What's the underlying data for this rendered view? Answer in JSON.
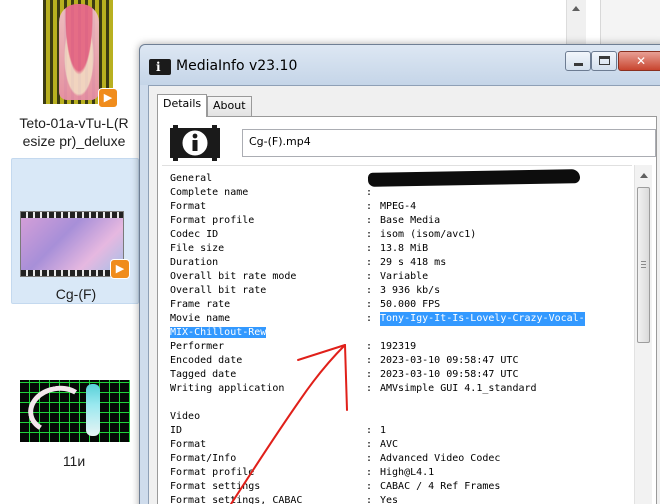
{
  "explorer": {
    "items": [
      {
        "label": "Teto-01a-vTu-L(Resize pr)_deluxe",
        "label_lines": [
          "Teto-01a-vTu-L(R",
          "esize pr)_deluxe"
        ],
        "selected": false
      },
      {
        "label": "Cg-(F)",
        "selected": true
      },
      {
        "label": "11и",
        "selected": false
      }
    ]
  },
  "window": {
    "title": "MediaInfo v23.10",
    "buttons": {
      "minimize_icon": "minimize-icon",
      "maximize_icon": "maximize-icon",
      "close_glyph": "✕"
    },
    "tabs": [
      {
        "label": "Details",
        "active": true
      },
      {
        "label": "About",
        "active": false
      }
    ],
    "file_name": "Cg-(F).mp4",
    "info": {
      "general": {
        "heading": "General",
        "rows": [
          {
            "key": "Complete name",
            "value": ""
          },
          {
            "key": "Format",
            "value": "MPEG-4"
          },
          {
            "key": "Format profile",
            "value": "Base Media"
          },
          {
            "key": "Codec ID",
            "value": "isom (isom/avc1)"
          },
          {
            "key": "File size",
            "value": "13.8 MiB"
          },
          {
            "key": "Duration",
            "value": "29 s 418 ms"
          },
          {
            "key": "Overall bit rate mode",
            "value": "Variable"
          },
          {
            "key": "Overall bit rate",
            "value": "3 936 kb/s"
          },
          {
            "key": "Frame rate",
            "value": "50.000 FPS"
          },
          {
            "key": "Movie name",
            "value": "Tony-Igy-It-Is-Lovely-Crazy-Vocal-",
            "value_continued": "MIX-Chillout-Rew"
          },
          {
            "key": "Performer",
            "value": "192319"
          },
          {
            "key": "Encoded date",
            "value": "2023-03-10 09:58:47 UTC"
          },
          {
            "key": "Tagged date",
            "value": "2023-03-10 09:58:47 UTC"
          },
          {
            "key": "Writing application",
            "value": "AMVsimple GUI 4.1_standard"
          }
        ]
      },
      "video": {
        "heading": "Video",
        "rows": [
          {
            "key": "ID",
            "value": "1"
          },
          {
            "key": "Format",
            "value": "AVC"
          },
          {
            "key": "Format/Info",
            "value": "Advanced Video Codec"
          },
          {
            "key": "Format profile",
            "value": "High@L4.1"
          },
          {
            "key": "Format settings",
            "value": "CABAC / 4 Ref Frames"
          },
          {
            "key": "Format settings, CABAC",
            "value": "Yes"
          }
        ]
      },
      "separator": ":"
    }
  },
  "colors": {
    "selection": "#3399ff",
    "annotation_arrow": "#e0201a",
    "window_frame": "#cfdcec"
  }
}
